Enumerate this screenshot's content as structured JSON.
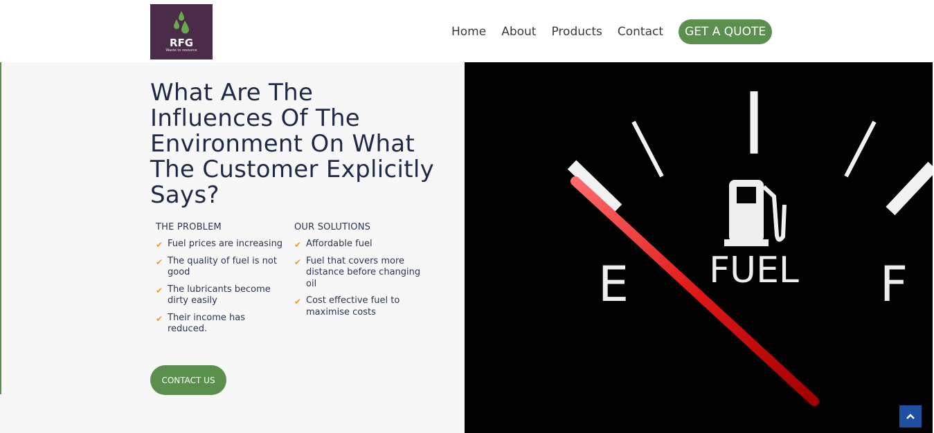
{
  "logo": {
    "name": "RFG",
    "tagline": "Waste to resource"
  },
  "nav": {
    "items": [
      "Home",
      "About",
      "Products",
      "Contact"
    ],
    "cta": "GET A QUOTE"
  },
  "hero": {
    "headline": "What Are The Influences Of The Environment On What The Customer Explicitly Says?",
    "problem": {
      "title": "THE PROBLEM",
      "items": [
        "Fuel prices are increasing",
        "The quality of fuel is not good",
        "The lubricants become dirty easily",
        "Their income has reduced."
      ]
    },
    "solutions": {
      "title": "OUR SOLUTIONS",
      "items": [
        "Affordable fuel",
        "Fuel that covers more distance before changing oil",
        "Cost effective fuel to maximise costs"
      ]
    },
    "contact_button": "CONTACT US"
  },
  "gauge": {
    "empty_label": "E",
    "fuel_label": "FUEL",
    "full_label": "F"
  },
  "colors": {
    "brand_green": "#5a8f4e",
    "logo_purple": "#4a2c49",
    "heading_navy": "#1e2a45",
    "check_orange": "#f39c12",
    "scroll_blue": "#1e4fa0"
  },
  "icons": {
    "check": "check-icon",
    "scroll_top": "chevron-up-icon",
    "logo_drops": "water-drops-icon"
  }
}
